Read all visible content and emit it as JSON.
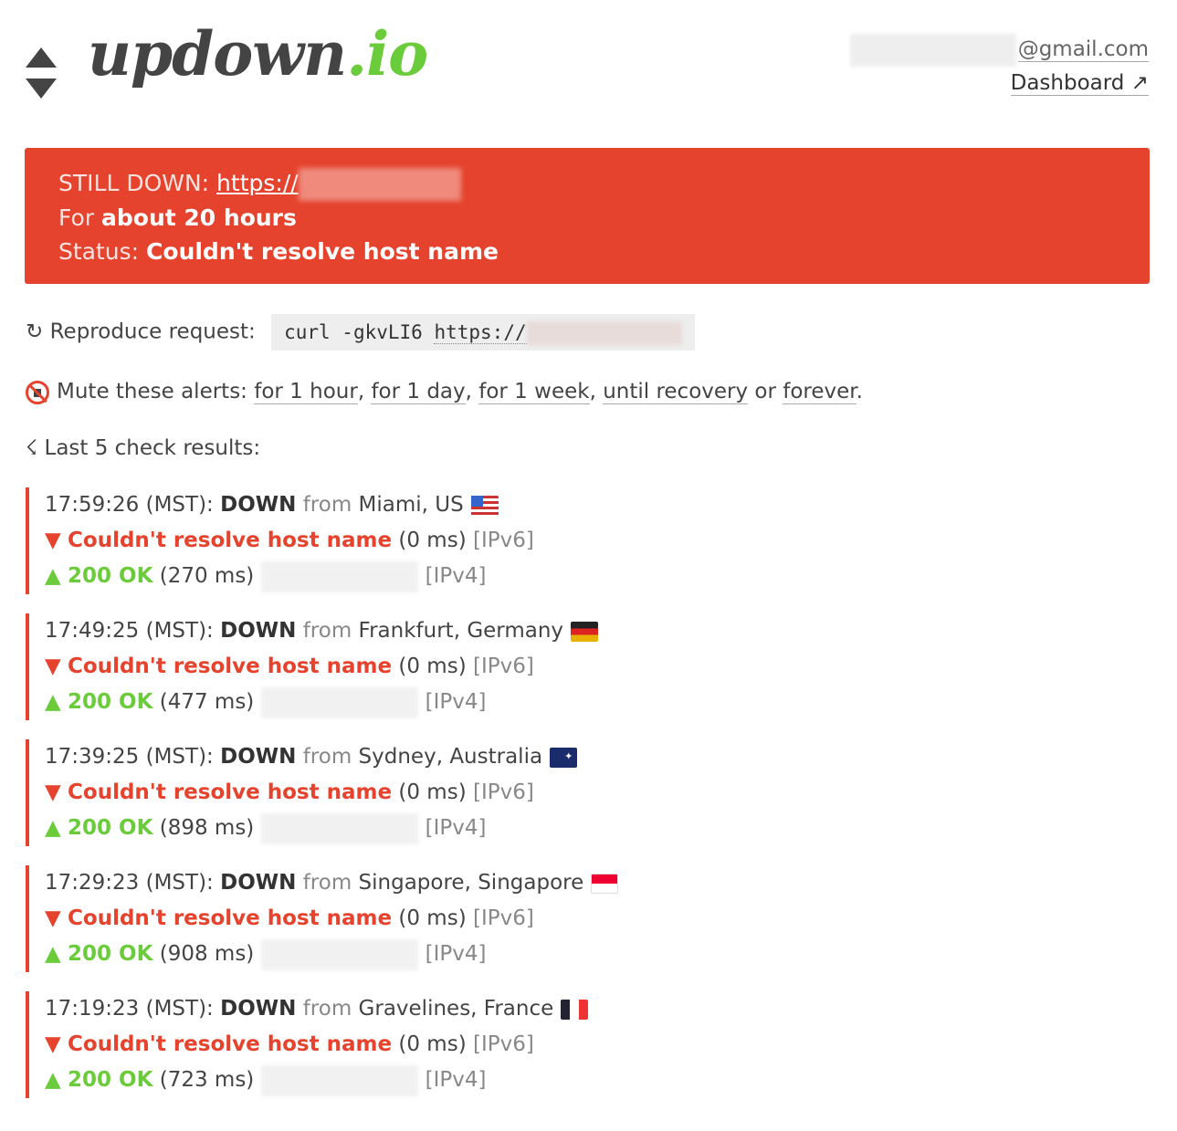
{
  "logo": {
    "name": "updown",
    "tld": ".io"
  },
  "account": {
    "email_suffix": "@gmail.com",
    "dashboard_label": "Dashboard ↗"
  },
  "alert": {
    "status_prefix": "STILL DOWN:",
    "url_visible": "https://",
    "duration_prefix": "For",
    "duration_value": "about 20 hours",
    "status_label": "Status:",
    "status_value": "Couldn't resolve host name"
  },
  "reproduce": {
    "icon": "↻",
    "label": "Reproduce request:",
    "command": "curl -gkvLI6",
    "url": "https://"
  },
  "mute": {
    "label": "Mute these alerts:",
    "options": [
      "for 1 hour",
      "for 1 day",
      "for 1 week",
      "until recovery",
      "forever"
    ],
    "sep": ", ",
    "or": "or",
    "end": "."
  },
  "last": {
    "icon": "☇",
    "label": "Last 5 check results:"
  },
  "results": [
    {
      "time": "17:59:26 (MST):",
      "state": "DOWN",
      "from": "from",
      "location": "Miami, US",
      "flag": "us",
      "ipv6_error": "Couldn't resolve host name",
      "ipv6_ms": "(0 ms)",
      "ipv6_tag": "[IPv6]",
      "ipv4_status": "200 OK",
      "ipv4_ms": "(270 ms)",
      "ipv4_tag": "[IPv4]"
    },
    {
      "time": "17:49:25 (MST):",
      "state": "DOWN",
      "from": "from",
      "location": "Frankfurt, Germany",
      "flag": "de",
      "ipv6_error": "Couldn't resolve host name",
      "ipv6_ms": "(0 ms)",
      "ipv6_tag": "[IPv6]",
      "ipv4_status": "200 OK",
      "ipv4_ms": "(477 ms)",
      "ipv4_tag": "[IPv4]"
    },
    {
      "time": "17:39:25 (MST):",
      "state": "DOWN",
      "from": "from",
      "location": "Sydney, Australia",
      "flag": "au",
      "ipv6_error": "Couldn't resolve host name",
      "ipv6_ms": "(0 ms)",
      "ipv6_tag": "[IPv6]",
      "ipv4_status": "200 OK",
      "ipv4_ms": "(898 ms)",
      "ipv4_tag": "[IPv4]"
    },
    {
      "time": "17:29:23 (MST):",
      "state": "DOWN",
      "from": "from",
      "location": "Singapore, Singapore",
      "flag": "sg",
      "ipv6_error": "Couldn't resolve host name",
      "ipv6_ms": "(0 ms)",
      "ipv6_tag": "[IPv6]",
      "ipv4_status": "200 OK",
      "ipv4_ms": "(908 ms)",
      "ipv4_tag": "[IPv4]"
    },
    {
      "time": "17:19:23 (MST):",
      "state": "DOWN",
      "from": "from",
      "location": "Gravelines, France",
      "flag": "fr",
      "ipv6_error": "Couldn't resolve host name",
      "ipv6_ms": "(0 ms)",
      "ipv6_tag": "[IPv6]",
      "ipv4_status": "200 OK",
      "ipv4_ms": "(723 ms)",
      "ipv4_tag": "[IPv4]"
    }
  ],
  "symbols": {
    "down": "▼",
    "up": "▲"
  },
  "colors": {
    "alert_red": "#e5432d",
    "ok_green": "#6bcc3b",
    "text": "#333333"
  }
}
